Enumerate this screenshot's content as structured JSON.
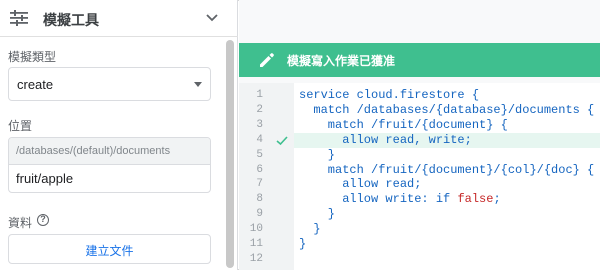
{
  "sidebar": {
    "title": "模擬工具",
    "type_label": "模擬類型",
    "type_value": "create",
    "location_label": "位置",
    "location_prefix": "/databases/(default)/documents",
    "location_value": "fruit/apple",
    "data_label": "資料",
    "create_doc_button": "建立文件"
  },
  "banner": {
    "message": "模擬寫入作業已獲准",
    "color": "#3fbf8f"
  },
  "editor": {
    "highlight_line": 4,
    "lines": [
      {
        "n": "1",
        "parts": [
          {
            "t": "service cloud.firestore {",
            "c": "#1565c0"
          }
        ]
      },
      {
        "n": "2",
        "parts": [
          {
            "t": "  match /databases/{database}/documents {",
            "c": "#1565c0"
          }
        ]
      },
      {
        "n": "3",
        "parts": [
          {
            "t": "    match /fruit/{document} {",
            "c": "#1565c0"
          }
        ]
      },
      {
        "n": "4",
        "parts": [
          {
            "t": "      allow read, write;",
            "c": "#1565c0"
          }
        ]
      },
      {
        "n": "5",
        "parts": [
          {
            "t": "    }",
            "c": "#1565c0"
          }
        ]
      },
      {
        "n": "6",
        "parts": [
          {
            "t": "    match /fruit/{document}/{col}/{doc} {",
            "c": "#1565c0"
          }
        ]
      },
      {
        "n": "7",
        "parts": [
          {
            "t": "      allow read;",
            "c": "#1565c0"
          }
        ]
      },
      {
        "n": "8",
        "parts": [
          {
            "t": "      allow write: if ",
            "c": "#1565c0"
          },
          {
            "t": "false",
            "c": "#c62828"
          },
          {
            "t": ";",
            "c": "#1565c0"
          }
        ]
      },
      {
        "n": "9",
        "parts": [
          {
            "t": "    }",
            "c": "#1565c0"
          }
        ]
      },
      {
        "n": "10",
        "parts": [
          {
            "t": "  }",
            "c": "#1565c0"
          }
        ]
      },
      {
        "n": "11",
        "parts": [
          {
            "t": "}",
            "c": "#1565c0"
          }
        ]
      },
      {
        "n": "12",
        "parts": []
      }
    ]
  }
}
